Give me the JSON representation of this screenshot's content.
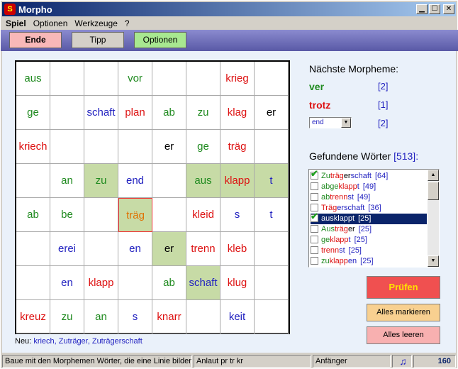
{
  "window": {
    "title": "Morpho",
    "app_icon": "S"
  },
  "menu": [
    "Spiel",
    "Optionen",
    "Werkzeuge",
    "?"
  ],
  "toolbar": {
    "end": "Ende",
    "tip": "Tipp",
    "options": "Optionen"
  },
  "grid": [
    [
      [
        "aus",
        "green"
      ],
      [
        "",
        ""
      ],
      [
        "",
        ""
      ],
      [
        "vor",
        "green"
      ],
      [
        "",
        ""
      ],
      [
        "",
        ""
      ],
      [
        "krieg",
        "red"
      ],
      [
        "",
        ""
      ]
    ],
    [
      [
        "ge",
        "green"
      ],
      [
        "",
        ""
      ],
      [
        "schaft",
        "blue"
      ],
      [
        "plan",
        "red"
      ],
      [
        "ab",
        "green"
      ],
      [
        "zu",
        "green"
      ],
      [
        "klag",
        "red"
      ],
      [
        "er",
        "black"
      ]
    ],
    [
      [
        "kriech",
        "red"
      ],
      [
        "",
        ""
      ],
      [
        "",
        ""
      ],
      [
        "",
        ""
      ],
      [
        "er",
        "black"
      ],
      [
        "ge",
        "green"
      ],
      [
        "träg",
        "red"
      ],
      [
        "",
        ""
      ]
    ],
    [
      [
        "",
        ""
      ],
      [
        "an",
        "green"
      ],
      [
        "zu",
        "green"
      ],
      [
        "end",
        "blue"
      ],
      [
        "",
        ""
      ],
      [
        "aus",
        "green"
      ],
      [
        "klapp",
        "red"
      ],
      [
        "t",
        "blue"
      ]
    ],
    [
      [
        "ab",
        "green"
      ],
      [
        "be",
        "green"
      ],
      [
        "",
        ""
      ],
      [
        "träg",
        "orange"
      ],
      [
        "",
        ""
      ],
      [
        "kleid",
        "red"
      ],
      [
        "s",
        "blue"
      ],
      [
        "t",
        "blue"
      ]
    ],
    [
      [
        "",
        ""
      ],
      [
        "erei",
        "blue"
      ],
      [
        "",
        ""
      ],
      [
        "en",
        "blue"
      ],
      [
        "er",
        "black"
      ],
      [
        "trenn",
        "red"
      ],
      [
        "kleb",
        "red"
      ],
      [
        "",
        ""
      ]
    ],
    [
      [
        "",
        ""
      ],
      [
        "en",
        "blue"
      ],
      [
        "klapp",
        "red"
      ],
      [
        "",
        ""
      ],
      [
        "ab",
        "green"
      ],
      [
        "schaft",
        "blue"
      ],
      [
        "klug",
        "red"
      ],
      [
        "",
        ""
      ]
    ],
    [
      [
        "kreuz",
        "red"
      ],
      [
        "zu",
        "green"
      ],
      [
        "an",
        "green"
      ],
      [
        "s",
        "blue"
      ],
      [
        "knarr",
        "red"
      ],
      [
        "",
        ""
      ],
      [
        "keit",
        "blue"
      ],
      [
        "",
        ""
      ]
    ]
  ],
  "new_words": {
    "label": "Neu:",
    "value": "kriech, Zuträger, Zuträgerschaft"
  },
  "next_morphemes": {
    "label": "Nächste Morpheme:",
    "items": [
      {
        "text": "ver",
        "color": "green",
        "count": "[2]"
      },
      {
        "text": "trotz",
        "color": "red",
        "count": "[1]"
      },
      {
        "text": "end",
        "color": "combo",
        "count": "[2]"
      }
    ]
  },
  "found_words": {
    "label": "Gefundene Wörter",
    "count": "[513]:",
    "items": [
      {
        "checked": true,
        "parts": [
          [
            "Zu",
            "green"
          ],
          [
            "träg",
            "red"
          ],
          [
            "er",
            "black"
          ],
          [
            "schaft",
            "blue"
          ]
        ],
        "count": "[64]",
        "active": false
      },
      {
        "checked": false,
        "parts": [
          [
            "abge",
            "green"
          ],
          [
            "klapp",
            "red"
          ],
          [
            "t",
            "blue"
          ]
        ],
        "count": "[49]",
        "active": false
      },
      {
        "checked": false,
        "parts": [
          [
            "ab",
            "green"
          ],
          [
            "trenn",
            "red"
          ],
          [
            "st",
            "blue"
          ]
        ],
        "count": "[49]",
        "active": false
      },
      {
        "checked": false,
        "parts": [
          [
            "Träg",
            "red"
          ],
          [
            "erschaft",
            "blue"
          ]
        ],
        "count": "[36]",
        "active": false
      },
      {
        "checked": true,
        "parts": [
          [
            "aus",
            "white"
          ],
          [
            "klapp",
            "white"
          ],
          [
            "t",
            "white"
          ]
        ],
        "count": "[25]",
        "active": true
      },
      {
        "checked": false,
        "parts": [
          [
            "Aus",
            "green"
          ],
          [
            "träg",
            "red"
          ],
          [
            "er",
            "black"
          ]
        ],
        "count": "[25]",
        "active": false
      },
      {
        "checked": false,
        "parts": [
          [
            "ge",
            "green"
          ],
          [
            "klapp",
            "red"
          ],
          [
            "t",
            "blue"
          ]
        ],
        "count": "[25]",
        "active": false
      },
      {
        "checked": false,
        "parts": [
          [
            "trenn",
            "red"
          ],
          [
            "st",
            "blue"
          ]
        ],
        "count": "[25]",
        "active": false
      },
      {
        "checked": false,
        "parts": [
          [
            "zu",
            "green"
          ],
          [
            "klapp",
            "red"
          ],
          [
            "en",
            "blue"
          ]
        ],
        "count": "[25]",
        "active": false
      }
    ]
  },
  "buttons": {
    "check": "Prüfen",
    "mark_all": "Alles markieren",
    "clear_all": "Alles leeren"
  },
  "status": {
    "hint": "Baue mit den Morphemen Wörter, die eine Linie bilden.",
    "sounds": "Anlaut pr tr kr",
    "level": "Anfänger",
    "score": "160"
  },
  "colors": {
    "green": "#1f8a1f",
    "red": "#dd1111",
    "blue": "#2222c0",
    "highlight": "#c7dba6",
    "toolbar": "#6a6ab2"
  }
}
